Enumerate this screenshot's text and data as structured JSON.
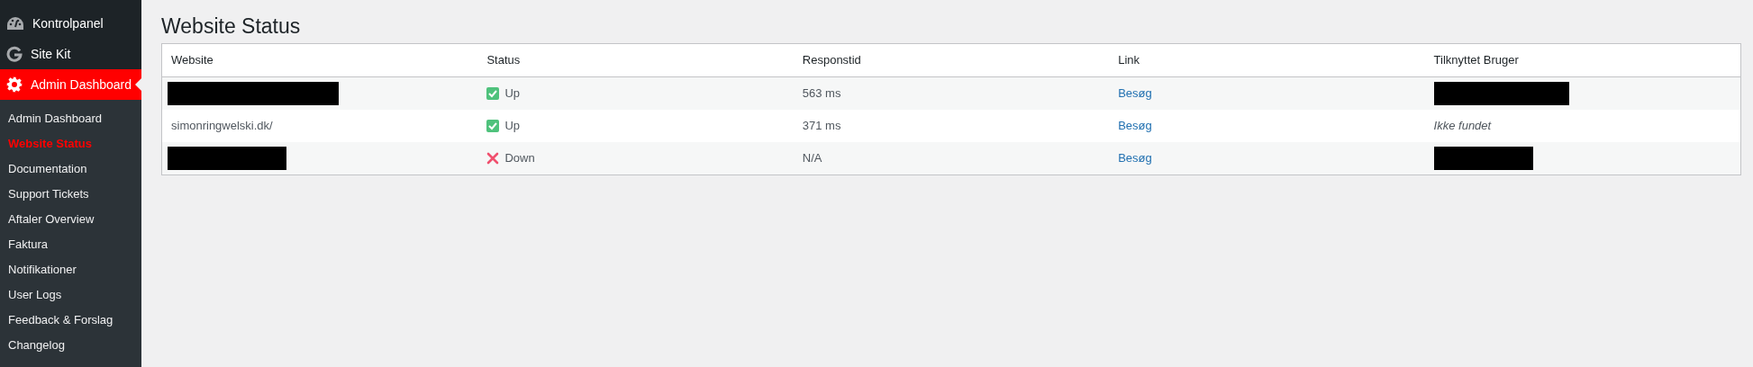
{
  "sidebar": {
    "menu": [
      {
        "label": "Kontrolpanel",
        "kind": "gauge",
        "selected": false
      },
      {
        "label": "Site Kit",
        "kind": "g",
        "selected": false
      },
      {
        "label": "Admin Dashboard",
        "kind": "gear",
        "selected": true
      }
    ],
    "submenu": [
      {
        "label": "Admin Dashboard",
        "selected": false
      },
      {
        "label": "Website Status",
        "selected": true
      },
      {
        "label": "Documentation",
        "selected": false
      },
      {
        "label": "Support Tickets",
        "selected": false
      },
      {
        "label": "Aftaler Overview",
        "selected": false
      },
      {
        "label": "Faktura",
        "selected": false
      },
      {
        "label": "Notifikationer",
        "selected": false
      },
      {
        "label": "User Logs",
        "selected": false
      },
      {
        "label": "Feedback & Forslag",
        "selected": false
      },
      {
        "label": "Changelog",
        "selected": false
      }
    ]
  },
  "page_title": "Website Status",
  "table": {
    "columns": [
      "Website",
      "Status",
      "Responstid",
      "Link",
      "Tilknyttet Bruger"
    ],
    "rows": [
      {
        "website": {
          "kind": "redacted"
        },
        "status": {
          "up": true,
          "text": "Up"
        },
        "response": "563 ms",
        "link": "Besøg",
        "user": {
          "kind": "redacted"
        }
      },
      {
        "website": {
          "kind": "text",
          "text": "simonringwelski.dk/"
        },
        "status": {
          "up": true,
          "text": "Up"
        },
        "response": "371 ms",
        "link": "Besøg",
        "user": {
          "kind": "missing",
          "text": "Ikke fundet"
        }
      },
      {
        "website": {
          "kind": "redacted"
        },
        "status": {
          "up": false,
          "text": "Down"
        },
        "response": "N/A",
        "link": "Besøg",
        "user": {
          "kind": "redacted"
        }
      }
    ]
  }
}
